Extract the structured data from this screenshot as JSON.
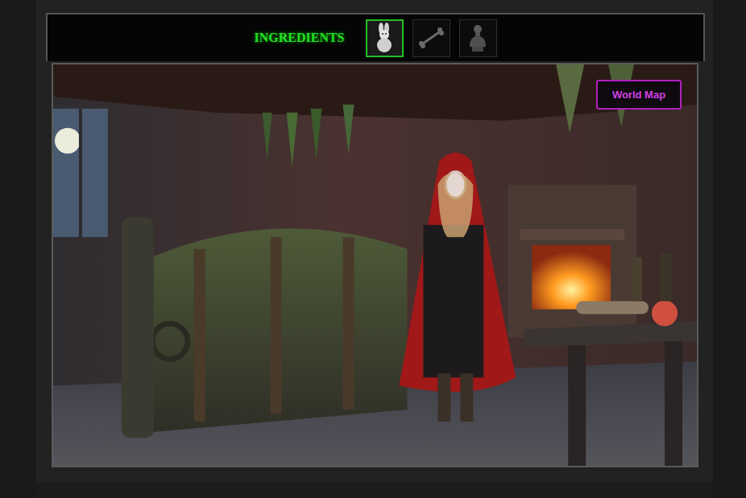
{
  "header": {
    "title": "INGREDIENTS"
  },
  "ingredients": [
    {
      "kind": "rabbit",
      "selected": true
    },
    {
      "kind": "bone",
      "selected": false
    },
    {
      "kind": "bust",
      "selected": false
    }
  ],
  "scene": {
    "map_button": "World Map"
  }
}
